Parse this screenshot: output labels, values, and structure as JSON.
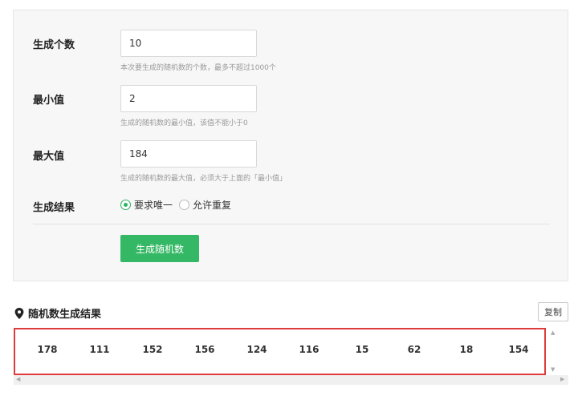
{
  "form": {
    "count": {
      "label": "生成个数",
      "value": "10",
      "hint": "本次要生成的随机数的个数，最多不超过1000个"
    },
    "min": {
      "label": "最小值",
      "value": "2",
      "hint": "生成的随机数的最小值，该值不能小于0"
    },
    "max": {
      "label": "最大值",
      "value": "184",
      "hint": "生成的随机数的最大值，必须大于上面的「最小值」"
    },
    "mode": {
      "label": "生成结果",
      "options": [
        "要求唯一",
        "允许重复"
      ],
      "selected": "要求唯一"
    },
    "generate_label": "生成随机数"
  },
  "result": {
    "title": "随机数生成结果",
    "copy_label": "复制",
    "numbers": [
      "178",
      "111",
      "152",
      "156",
      "124",
      "116",
      "15",
      "62",
      "18",
      "154"
    ]
  },
  "colors": {
    "accent": "#35b865",
    "highlight": "#e03b3b"
  },
  "icons": {
    "title_icon": "map-pin-icon"
  }
}
